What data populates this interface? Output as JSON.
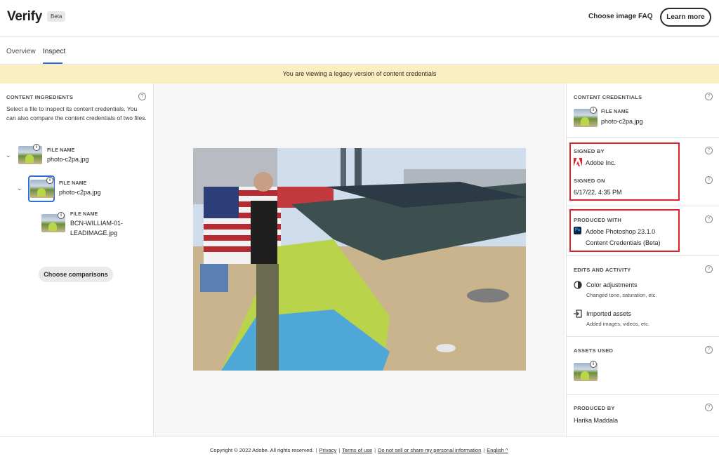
{
  "header": {
    "app_title": "Verify",
    "badge": "Beta",
    "choose_image": "Choose image",
    "faq": "FAQ",
    "learn_more": "Learn more"
  },
  "tabs": [
    {
      "label": "Overview",
      "active": false
    },
    {
      "label": "Inspect",
      "active": true
    }
  ],
  "banner": "You are viewing a legacy version of content credentials",
  "left_panel": {
    "title": "CONTENT INGREDIENTS",
    "description": "Select a file to inspect its content credentials. You can also compare the content credentials of two files.",
    "tree": [
      {
        "label": "FILE NAME",
        "value": "photo-c2pa.jpg"
      },
      {
        "label": "FILE NAME",
        "value": "photo-c2pa.jpg",
        "selected": true
      },
      {
        "label": "FILE NAME",
        "value_line1": "BCN-WILLIAM-01-",
        "value_line2": "LEADIMAGE.jpg"
      }
    ],
    "compare_button": "Choose comparisons"
  },
  "right_panel": {
    "content_credentials": {
      "title": "CONTENT CREDENTIALS",
      "file_label": "FILE NAME",
      "file_name": "photo-c2pa.jpg"
    },
    "signed_by": {
      "label": "SIGNED BY",
      "value": "Adobe Inc."
    },
    "signed_on": {
      "label": "SIGNED ON",
      "value": "6/17/22, 4:35 PM"
    },
    "produced_with": {
      "label": "PRODUCED WITH",
      "app": "Adobe Photoshop 23.1.0",
      "detail": "Content Credentials (Beta)"
    },
    "edits": {
      "title": "EDITS AND ACTIVITY",
      "items": [
        {
          "label": "Color adjustments",
          "detail": "Changed tone, saturation, etc.",
          "icon": "color-adjust-icon"
        },
        {
          "label": "Imported assets",
          "detail": "Added images, videos, etc.",
          "icon": "import-icon"
        }
      ]
    },
    "assets_used": {
      "title": "ASSETS USED"
    },
    "produced_by": {
      "title": "PRODUCED BY",
      "value": "Harika Maddala"
    }
  },
  "footer": {
    "copyright": "Copyright © 2022 Adobe. All rights reserved.",
    "privacy": "Privacy",
    "terms": "Terms of use",
    "do_not_sell": "Do not sell or share my personal information",
    "language": "English ^"
  },
  "colors": {
    "accent": "#2c6fd6",
    "banner_bg": "#fbeec0",
    "highlight_red": "#e0232b"
  }
}
